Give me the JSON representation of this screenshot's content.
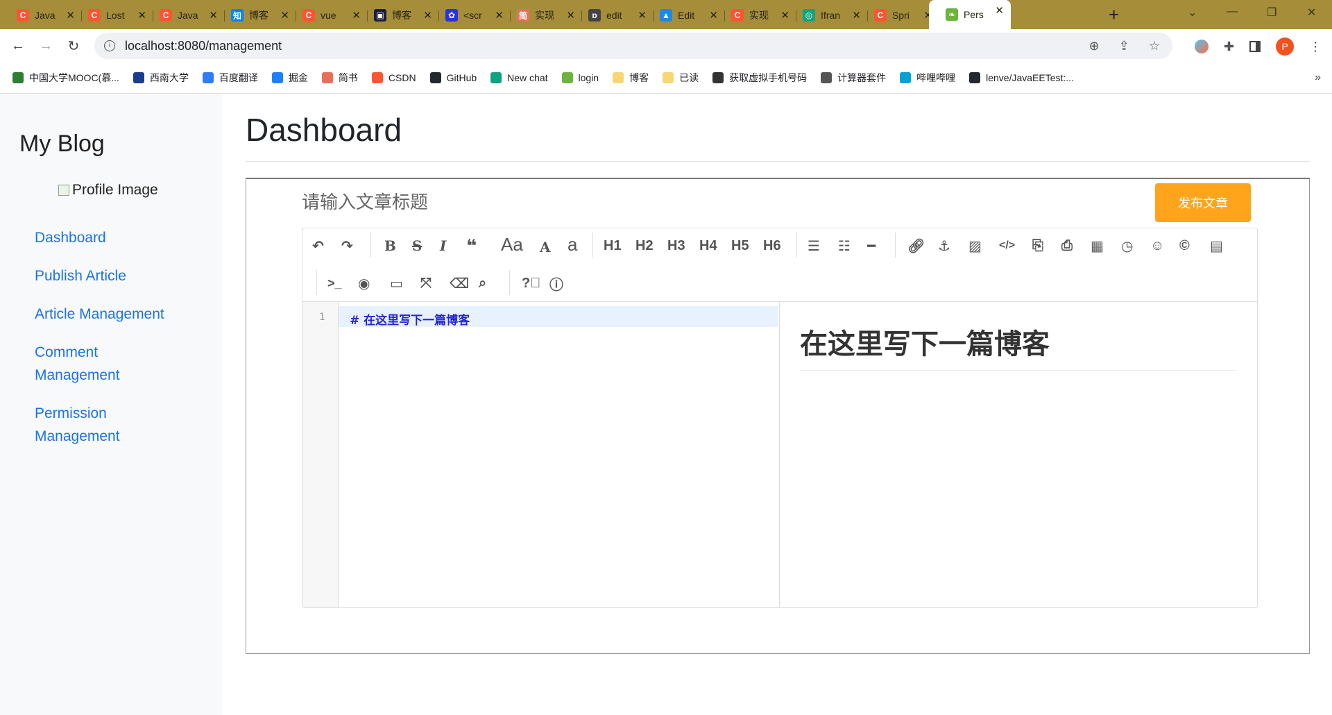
{
  "browser": {
    "tabs": [
      {
        "title": "Java",
        "icon_text": "C",
        "icon_color": "#fc5531"
      },
      {
        "title": "Lost",
        "icon_text": "C",
        "icon_color": "#fc5531"
      },
      {
        "title": "Java",
        "icon_text": "C",
        "icon_color": "#fc5531"
      },
      {
        "title": "博客",
        "icon_text": "知",
        "icon_color": "#0084ff"
      },
      {
        "title": "vue",
        "icon_text": "C",
        "icon_color": "#fc5531"
      },
      {
        "title": "博客",
        "icon_text": "▣",
        "icon_color": "#1d1d3a"
      },
      {
        "title": "<scr",
        "icon_text": "✿",
        "icon_color": "#2932e1"
      },
      {
        "title": "实现",
        "icon_text": "简",
        "icon_color": "#ea6f5a"
      },
      {
        "title": "edit",
        "icon_text": "ɒ",
        "icon_color": "#444444"
      },
      {
        "title": "Edit",
        "icon_text": "▲",
        "icon_color": "#1e88e5"
      },
      {
        "title": "实现",
        "icon_text": "C",
        "icon_color": "#fc5531"
      },
      {
        "title": "Ifran",
        "icon_text": "◎",
        "icon_color": "#10a37f"
      },
      {
        "title": "Spri",
        "icon_text": "C",
        "icon_color": "#fc5531"
      },
      {
        "title": "Pers",
        "icon_text": "❧",
        "icon_color": "#6db33f"
      }
    ],
    "url": "localhost:8080/management",
    "profile_initial": "P",
    "bookmarks": [
      {
        "label": "中国大学MOOC(慕...",
        "color": "#2e7d32"
      },
      {
        "label": "西南大学",
        "color": "#1a3d8f"
      },
      {
        "label": "百度翻译",
        "color": "#2f7cf6"
      },
      {
        "label": "掘金",
        "color": "#1e80ff"
      },
      {
        "label": "简书",
        "color": "#ea6f5a"
      },
      {
        "label": "CSDN",
        "color": "#fc5531"
      },
      {
        "label": "GitHub",
        "color": "#24292f"
      },
      {
        "label": "New chat",
        "color": "#10a37f"
      },
      {
        "label": "login",
        "color": "#6db33f"
      },
      {
        "label": "博客",
        "color": "#f7d774"
      },
      {
        "label": "已读",
        "color": "#f7d774"
      },
      {
        "label": "获取虚拟手机号码",
        "color": "#333333"
      },
      {
        "label": "计算器套件",
        "color": "#555555"
      },
      {
        "label": "哔哩哔哩",
        "color": "#00a1d6"
      },
      {
        "label": "lenve/JavaEETest:...",
        "color": "#24292f"
      }
    ]
  },
  "sidebar": {
    "brand": "My Blog",
    "profile_alt": "Profile Image",
    "items": [
      {
        "label": "Dashboard"
      },
      {
        "label": "Publish Article"
      },
      {
        "label": "Article Management"
      },
      {
        "label": "Comment Management"
      },
      {
        "label": "Permission Management"
      }
    ]
  },
  "main": {
    "title": "Dashboard",
    "title_placeholder": "请输入文章标题",
    "publish_label": "发布文章",
    "toolbar": {
      "headings": [
        "H1",
        "H2",
        "H3",
        "H4",
        "H5",
        "H6"
      ]
    },
    "editor": {
      "line_number": "1",
      "content": "# 在这里写下一篇博客",
      "preview_heading": "在这里写下一篇博客"
    }
  },
  "colors": {
    "accent": "#ffa41b",
    "link": "#1a73e8",
    "tabbar": "#a58d3a"
  }
}
